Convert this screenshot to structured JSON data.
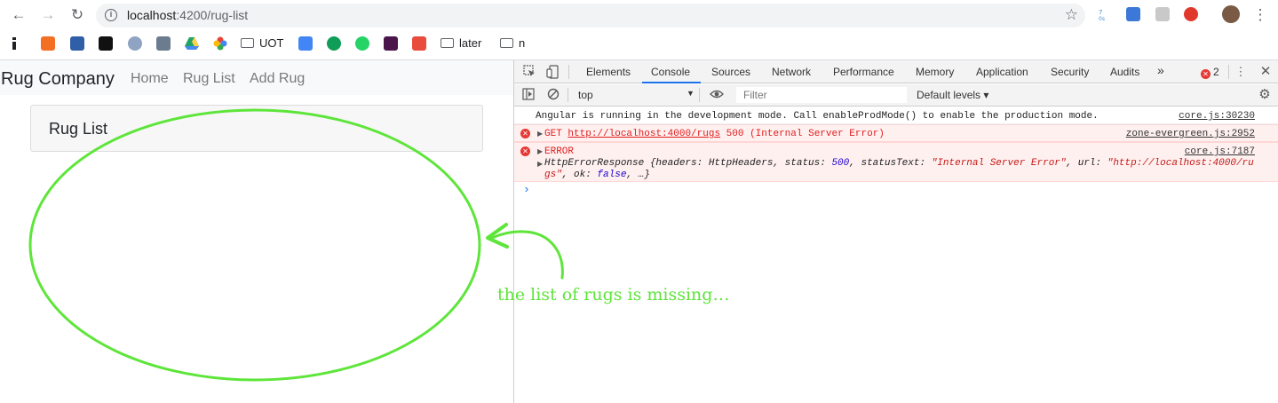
{
  "browser": {
    "url_host": "localhost",
    "url_rest": ":4200/rug-list",
    "bookmarks": [
      "UOT",
      "later",
      "n"
    ]
  },
  "app": {
    "brand": "Rug Company",
    "nav": [
      "Home",
      "Rug List",
      "Add Rug"
    ],
    "card_title": "Rug List"
  },
  "devtools": {
    "tabs": [
      "Elements",
      "Console",
      "Sources",
      "Network",
      "Performance",
      "Memory",
      "Application",
      "Security",
      "Audits"
    ],
    "more": "»",
    "error_count": "2",
    "context": "top",
    "filter_placeholder": "Filter",
    "levels": "Default levels ▾",
    "messages": {
      "m1_text": "Angular is running in the development mode. Call enableProdMode() to enable the production mode.",
      "m1_src": "core.js:30230",
      "m2_method": "GET",
      "m2_url": "http://localhost:4000/rugs",
      "m2_status": "500 (Internal Server Error)",
      "m2_src": "zone-evergreen.js:2952",
      "m3_label": "ERROR",
      "m3_src": "core.js:7187",
      "m3_obj_a": "HttpErrorResponse {headers: HttpHeaders, status: ",
      "m3_status": "500",
      "m3_obj_b": ", statusText: ",
      "m3_statusText": "\"Internal Server Error\"",
      "m3_obj_c": ", url: ",
      "m3_url_a": "\"http://localhost:4000/ru",
      "m3_url_b": "gs\"",
      "m3_obj_d": ", ok: ",
      "m3_ok": "false",
      "m3_obj_e": ", …}"
    }
  },
  "annotation": {
    "text": "the list of rugs is missing…",
    "color": "#5ee53a"
  }
}
